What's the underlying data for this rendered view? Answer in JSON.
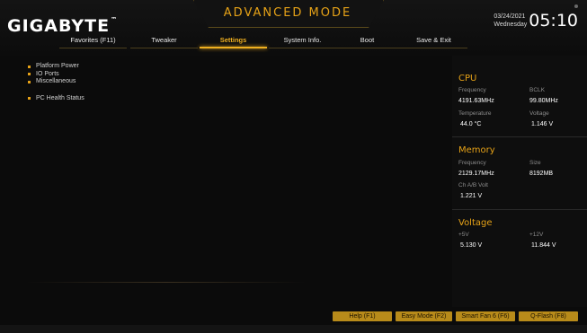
{
  "brand": {
    "name": "GIGABYTE",
    "trademark": "™"
  },
  "mode_title": "ADVANCED MODE",
  "datetime": {
    "date": "03/24/2021",
    "weekday": "Wednesday",
    "time": "05:10"
  },
  "menu": [
    {
      "label": "Favorites (F11)",
      "active": false
    },
    {
      "label": "Tweaker",
      "active": false
    },
    {
      "label": "Settings",
      "active": true
    },
    {
      "label": "System Info.",
      "active": false
    },
    {
      "label": "Boot",
      "active": false
    },
    {
      "label": "Save & Exit",
      "active": false
    }
  ],
  "options": [
    "Platform Power",
    "IO Ports",
    "Miscellaneous",
    "PC Health Status"
  ],
  "cpu": {
    "title": "CPU",
    "frequency_label": "Frequency",
    "frequency": "4191.63MHz",
    "bclk_label": "BCLK",
    "bclk": "99.80MHz",
    "temperature_label": "Temperature",
    "temperature": "44.0 °C",
    "voltage_label": "Voltage",
    "voltage": "1.146 V"
  },
  "memory": {
    "title": "Memory",
    "frequency_label": "Frequency",
    "frequency": "2129.17MHz",
    "size_label": "Size",
    "size": "8192MB",
    "chab_label": "Ch A/B Volt",
    "chab": "1.221 V"
  },
  "voltage": {
    "title": "Voltage",
    "p5v_label": "+5V",
    "p5v": "5.130 V",
    "p12v_label": "+12V",
    "p12v": "11.844 V"
  },
  "function_buttons": {
    "help": "Help (F1)",
    "easy_mode": "Easy Mode (F2)",
    "smart_fan": "Smart Fan 6 (F6)",
    "qflash": "Q-Flash (F8)"
  },
  "colors": {
    "accent": "#e6a217",
    "button": "#b88b1a",
    "background": "#0b0b0b"
  }
}
